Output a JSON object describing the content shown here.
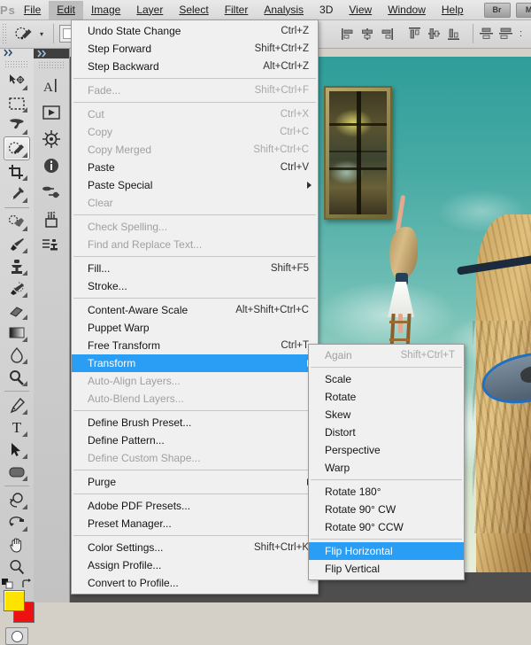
{
  "app": {
    "name": "Adobe Photoshop",
    "logo_text": "Ps"
  },
  "menubar": {
    "items": [
      {
        "label": "File",
        "active": false
      },
      {
        "label": "Edit",
        "active": true
      },
      {
        "label": "Image",
        "active": false
      },
      {
        "label": "Layer",
        "active": false
      },
      {
        "label": "Select",
        "active": false
      },
      {
        "label": "Filter",
        "active": false
      },
      {
        "label": "Analysis",
        "active": false
      },
      {
        "label": "3D",
        "active": false
      },
      {
        "label": "View",
        "active": false
      },
      {
        "label": "Window",
        "active": false
      },
      {
        "label": "Help",
        "active": false
      }
    ],
    "buttons": [
      {
        "label": "Br",
        "name": "launch-bridge-button"
      },
      {
        "label": "M",
        "name": "launch-mini-bridge-button"
      }
    ]
  },
  "options_bar": {
    "current_tool_icon": "quick-selection-tool-icon",
    "preset_picker_caret": "▾",
    "brush_preset_label": "",
    "align_icons": [
      "align-left-edges-icon",
      "align-horizontal-centers-icon",
      "align-right-edges-icon",
      "align-top-edges-icon",
      "align-vertical-centers-icon",
      "align-bottom-edges-icon",
      "distribute-top-edges-icon",
      "distribute-vertical-centers-icon"
    ]
  },
  "toolbox": {
    "collapse_label": "▸▸",
    "tools": [
      {
        "name": "move-tool",
        "icon": "move-tool-icon",
        "selected": false,
        "has_flyout": true
      },
      {
        "name": "rectangular-marquee-tool",
        "icon": "marquee-tool-icon",
        "selected": false,
        "has_flyout": true
      },
      {
        "name": "lasso-tool",
        "icon": "lasso-tool-icon",
        "selected": false,
        "has_flyout": true
      },
      {
        "name": "quick-selection-tool",
        "icon": "quick-selection-tool-icon",
        "selected": true,
        "has_flyout": true
      },
      {
        "name": "crop-tool",
        "icon": "crop-tool-icon",
        "selected": false,
        "has_flyout": true
      },
      {
        "name": "eyedropper-tool",
        "icon": "eyedropper-tool-icon",
        "selected": false,
        "has_flyout": true
      },
      {
        "name": "spot-healing-brush-tool",
        "icon": "healing-brush-tool-icon",
        "selected": false,
        "has_flyout": true
      },
      {
        "name": "brush-tool",
        "icon": "brush-tool-icon",
        "selected": false,
        "has_flyout": true
      },
      {
        "name": "clone-stamp-tool",
        "icon": "clone-stamp-tool-icon",
        "selected": false,
        "has_flyout": true
      },
      {
        "name": "history-brush-tool",
        "icon": "history-brush-tool-icon",
        "selected": false,
        "has_flyout": true
      },
      {
        "name": "eraser-tool",
        "icon": "eraser-tool-icon",
        "selected": false,
        "has_flyout": true
      },
      {
        "name": "gradient-tool",
        "icon": "gradient-tool-icon",
        "selected": false,
        "has_flyout": true
      },
      {
        "name": "blur-tool",
        "icon": "blur-tool-icon",
        "selected": false,
        "has_flyout": true
      },
      {
        "name": "dodge-tool",
        "icon": "dodge-tool-icon",
        "selected": false,
        "has_flyout": true
      },
      {
        "name": "pen-tool",
        "icon": "pen-tool-icon",
        "selected": false,
        "has_flyout": true
      },
      {
        "name": "horizontal-type-tool",
        "icon": "type-tool-icon",
        "selected": false,
        "has_flyout": true
      },
      {
        "name": "path-selection-tool",
        "icon": "path-selection-tool-icon",
        "selected": false,
        "has_flyout": true
      },
      {
        "name": "rounded-rectangle-tool",
        "icon": "shape-tool-icon",
        "selected": false,
        "has_flyout": true
      },
      {
        "name": "3d-object-rotate-tool",
        "icon": "3d-object-rotate-tool-icon",
        "selected": false,
        "has_flyout": true
      },
      {
        "name": "3d-camera-rotate-tool",
        "icon": "3d-camera-rotate-tool-icon",
        "selected": false,
        "has_flyout": true
      },
      {
        "name": "hand-tool",
        "icon": "hand-tool-icon",
        "selected": false,
        "has_flyout": false
      },
      {
        "name": "zoom-tool",
        "icon": "zoom-tool-icon",
        "selected": false,
        "has_flyout": false
      }
    ],
    "default_colors_icon": "default-foreground-background-icon",
    "swap_colors_icon": "swap-colors-icon",
    "foreground_color": "#ffe300",
    "background_color": "#ee1111",
    "quick_mask_icon": "quick-mask-mode-icon"
  },
  "panel_column": {
    "collapse_label": "▸▸",
    "items": [
      {
        "name": "panel-character",
        "icon": "character-panel-icon"
      },
      {
        "name": "panel-actions",
        "icon": "actions-play-icon"
      },
      {
        "name": "panel-3d",
        "icon": "3d-ship-wheel-icon"
      },
      {
        "name": "panel-info",
        "icon": "info-panel-icon"
      },
      {
        "name": "panel-adjustments",
        "icon": "adjustments-panel-icon"
      },
      {
        "name": "panel-masks",
        "icon": "masks-panel-icon"
      },
      {
        "name": "panel-clone-source",
        "icon": "clone-source-panel-icon"
      }
    ]
  },
  "edit_menu": {
    "title": "Edit",
    "items": [
      {
        "type": "item",
        "label": "Undo State Change",
        "accel": "Ctrl+Z",
        "disabled": false
      },
      {
        "type": "item",
        "label": "Step Forward",
        "accel": "Shift+Ctrl+Z",
        "disabled": false
      },
      {
        "type": "item",
        "label": "Step Backward",
        "accel": "Alt+Ctrl+Z",
        "disabled": false
      },
      {
        "type": "sep"
      },
      {
        "type": "item",
        "label": "Fade...",
        "accel": "Shift+Ctrl+F",
        "disabled": true
      },
      {
        "type": "sep"
      },
      {
        "type": "item",
        "label": "Cut",
        "accel": "Ctrl+X",
        "disabled": true
      },
      {
        "type": "item",
        "label": "Copy",
        "accel": "Ctrl+C",
        "disabled": true
      },
      {
        "type": "item",
        "label": "Copy Merged",
        "accel": "Shift+Ctrl+C",
        "disabled": true
      },
      {
        "type": "item",
        "label": "Paste",
        "accel": "Ctrl+V",
        "disabled": false
      },
      {
        "type": "item",
        "label": "Paste Special",
        "accel": "",
        "disabled": false,
        "submenu": true
      },
      {
        "type": "item",
        "label": "Clear",
        "accel": "",
        "disabled": true
      },
      {
        "type": "sep"
      },
      {
        "type": "item",
        "label": "Check Spelling...",
        "accel": "",
        "disabled": true
      },
      {
        "type": "item",
        "label": "Find and Replace Text...",
        "accel": "",
        "disabled": true
      },
      {
        "type": "sep"
      },
      {
        "type": "item",
        "label": "Fill...",
        "accel": "Shift+F5",
        "disabled": false
      },
      {
        "type": "item",
        "label": "Stroke...",
        "accel": "",
        "disabled": false
      },
      {
        "type": "sep"
      },
      {
        "type": "item",
        "label": "Content-Aware Scale",
        "accel": "Alt+Shift+Ctrl+C",
        "disabled": false
      },
      {
        "type": "item",
        "label": "Puppet Warp",
        "accel": "",
        "disabled": false
      },
      {
        "type": "item",
        "label": "Free Transform",
        "accel": "Ctrl+T",
        "disabled": false
      },
      {
        "type": "item",
        "label": "Transform",
        "accel": "",
        "disabled": false,
        "submenu": true,
        "highlighted": true
      },
      {
        "type": "item",
        "label": "Auto-Align Layers...",
        "accel": "",
        "disabled": true
      },
      {
        "type": "item",
        "label": "Auto-Blend Layers...",
        "accel": "",
        "disabled": true
      },
      {
        "type": "sep"
      },
      {
        "type": "item",
        "label": "Define Brush Preset...",
        "accel": "",
        "disabled": false
      },
      {
        "type": "item",
        "label": "Define Pattern...",
        "accel": "",
        "disabled": false
      },
      {
        "type": "item",
        "label": "Define Custom Shape...",
        "accel": "",
        "disabled": true
      },
      {
        "type": "sep"
      },
      {
        "type": "item",
        "label": "Purge",
        "accel": "",
        "disabled": false,
        "submenu": true
      },
      {
        "type": "sep"
      },
      {
        "type": "item",
        "label": "Adobe PDF Presets...",
        "accel": "",
        "disabled": false
      },
      {
        "type": "item",
        "label": "Preset Manager...",
        "accel": "",
        "disabled": false
      },
      {
        "type": "sep"
      },
      {
        "type": "item",
        "label": "Color Settings...",
        "accel": "Shift+Ctrl+K",
        "disabled": false
      },
      {
        "type": "item",
        "label": "Assign Profile...",
        "accel": "",
        "disabled": false
      },
      {
        "type": "item",
        "label": "Convert to Profile...",
        "accel": "",
        "disabled": false
      }
    ]
  },
  "transform_menu": {
    "title": "Transform",
    "items": [
      {
        "type": "item",
        "label": "Again",
        "accel": "Shift+Ctrl+T",
        "disabled": true
      },
      {
        "type": "sep"
      },
      {
        "type": "item",
        "label": "Scale",
        "accel": "",
        "disabled": false
      },
      {
        "type": "item",
        "label": "Rotate",
        "accel": "",
        "disabled": false
      },
      {
        "type": "item",
        "label": "Skew",
        "accel": "",
        "disabled": false
      },
      {
        "type": "item",
        "label": "Distort",
        "accel": "",
        "disabled": false
      },
      {
        "type": "item",
        "label": "Perspective",
        "accel": "",
        "disabled": false
      },
      {
        "type": "item",
        "label": "Warp",
        "accel": "",
        "disabled": false
      },
      {
        "type": "sep"
      },
      {
        "type": "item",
        "label": "Rotate 180°",
        "accel": "",
        "disabled": false
      },
      {
        "type": "item",
        "label": "Rotate 90° CW",
        "accel": "",
        "disabled": false
      },
      {
        "type": "item",
        "label": "Rotate 90° CCW",
        "accel": "",
        "disabled": false
      },
      {
        "type": "sep"
      },
      {
        "type": "item",
        "label": "Flip Horizontal",
        "accel": "",
        "disabled": false,
        "highlighted": true
      },
      {
        "type": "item",
        "label": "Flip Vertical",
        "accel": "",
        "disabled": false
      }
    ]
  },
  "document": {
    "description": "surreal composite photo: girl on wooden ladder reaching toward a floating window in a teal sky with clouds, a dog below, a giant wooden/elephant leg at right and ocean waves at the bottom",
    "sky_color": "#47aaa4",
    "ocean_color": "#18578e",
    "accent_color": "#2a9df4"
  }
}
